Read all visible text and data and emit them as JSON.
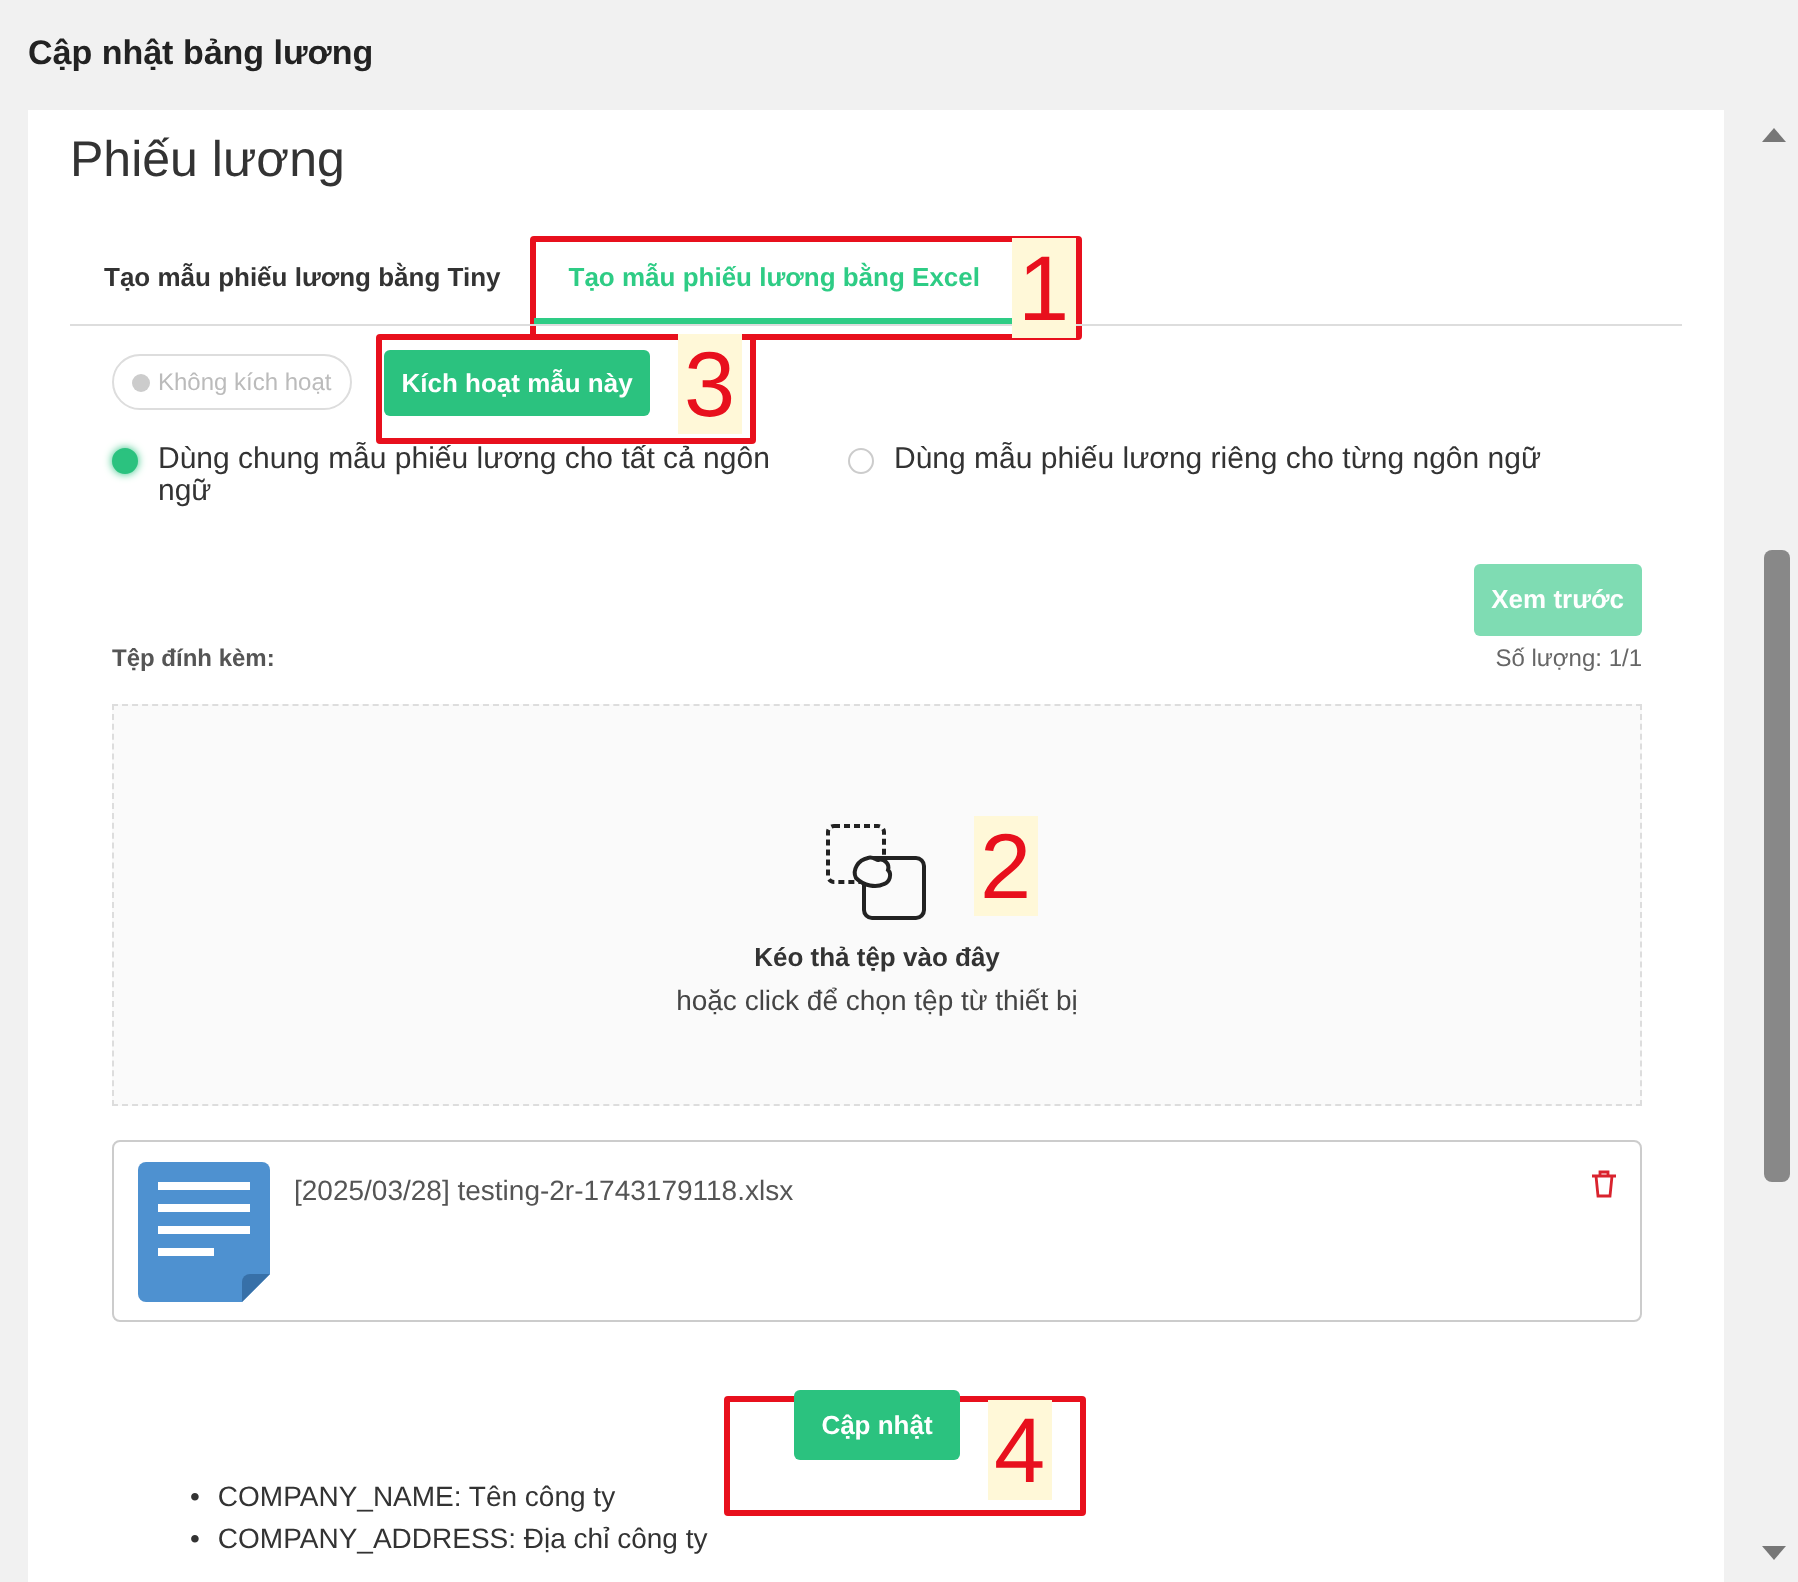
{
  "window": {
    "title": "Cập nhật bảng lương"
  },
  "heading": "Phiếu lương",
  "tabs": [
    {
      "label": "Tạo mẫu phiếu lương bằng Tiny",
      "selected": false
    },
    {
      "label": "Tạo mẫu phiếu lương bằng Excel",
      "selected": true
    }
  ],
  "status_badge": {
    "label": "Không kích hoạt",
    "active": false
  },
  "activate_button": "Kích hoạt mẫu này",
  "template_options": [
    {
      "label": "Dùng chung mẫu phiếu lương cho tất cả ngôn ngữ",
      "selected": true
    },
    {
      "label": "Dùng mẫu phiếu lương riêng cho từng ngôn ngữ",
      "selected": false
    }
  ],
  "preview_button": {
    "label": "Xem trước",
    "disabled": true
  },
  "attachment": {
    "label": "Tệp đính kèm:",
    "count": "Số lượng: 1/1",
    "drop_title": "Kéo thả tệp vào đây",
    "drop_hint": "hoặc click để chọn tệp từ thiết bị",
    "files": [
      {
        "name": "[2025/03/28] testing-2r-1743179118.xlsx"
      }
    ]
  },
  "update_button": "Cập nhật",
  "variables": [
    {
      "bullet": "•",
      "text": "COMPANY_NAME: Tên công ty"
    },
    {
      "bullet": "•",
      "text": "COMPANY_ADDRESS: Địa chỉ công ty"
    }
  ],
  "callouts": [
    {
      "number": "1"
    },
    {
      "number": "2"
    },
    {
      "number": "3"
    },
    {
      "number": "4"
    }
  ]
}
